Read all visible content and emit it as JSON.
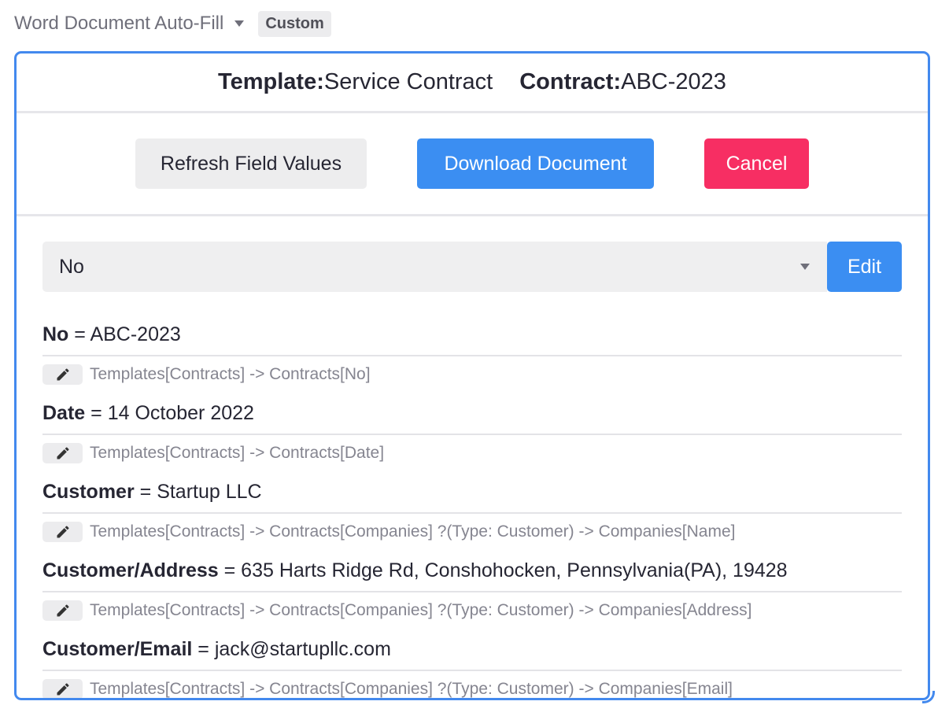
{
  "header": {
    "title": "Word Document Auto-Fill",
    "badge": "Custom"
  },
  "info": {
    "template_label": "Template:",
    "template_value": "Service Contract",
    "contract_label": "Contract:",
    "contract_value": "ABC-2023"
  },
  "buttons": {
    "refresh": "Refresh Field Values",
    "download": "Download Document",
    "cancel": "Cancel"
  },
  "selector": {
    "selected": "No",
    "edit_label": "Edit"
  },
  "fields": [
    {
      "name": "No",
      "value": "ABC-2023",
      "path": "Templates[Contracts] -> Contracts[No]"
    },
    {
      "name": "Date",
      "value": "14 October 2022",
      "path": "Templates[Contracts] -> Contracts[Date]"
    },
    {
      "name": "Customer",
      "value": "Startup LLC",
      "path": "Templates[Contracts] -> Contracts[Companies] ?(Type: Customer) -> Companies[Name]"
    },
    {
      "name": "Customer/Address",
      "value": "635 Harts Ridge Rd, Conshohocken, Pennsylvania(PA), 19428",
      "path": "Templates[Contracts] -> Contracts[Companies] ?(Type: Customer) -> Companies[Address]"
    },
    {
      "name": "Customer/Email",
      "value": "jack@startupllc.com",
      "path": "Templates[Contracts] -> Contracts[Companies] ?(Type: Customer) -> Companies[Email]"
    }
  ],
  "separator": " = ",
  "colors": {
    "accent": "#3b8ef2",
    "border": "#4389ee",
    "danger": "#f72e63"
  },
  "icons": {
    "edit_field": "pencil-icon",
    "dropdown": "chevron-down-icon"
  }
}
